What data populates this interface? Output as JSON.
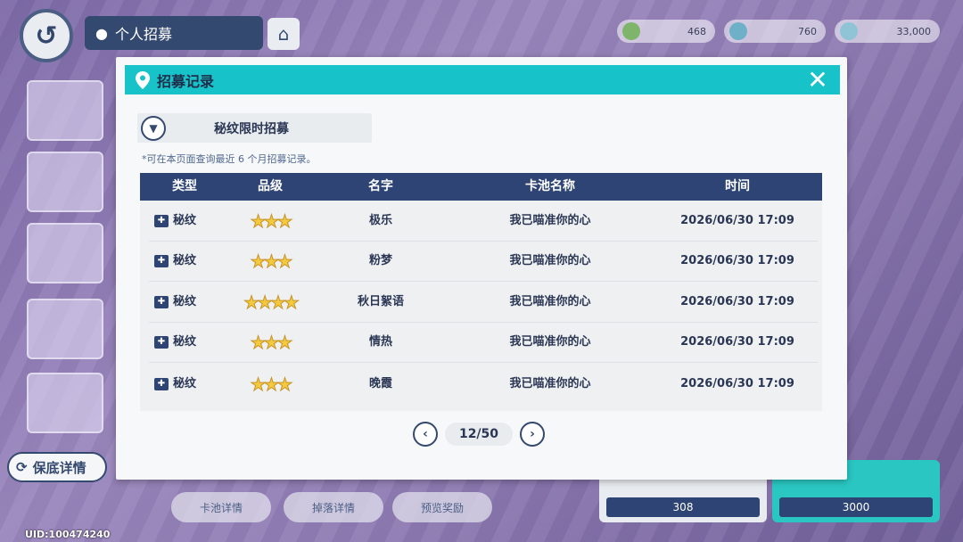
{
  "background": {
    "screen_title": "个人招募",
    "currencies": [
      "468",
      "760",
      "33,000"
    ],
    "bottom_buttons": [
      "卡池详情",
      "掉落详情",
      "预览奖励"
    ],
    "bottom_cards": [
      "308",
      "3000"
    ],
    "baodi_label": "保底详情",
    "uid": "UID:100474240"
  },
  "modal": {
    "title": "招募记录",
    "pool_select": "秘纹限时招募",
    "note": "*可在本页面查询最近 6 个月招募记录。",
    "columns": [
      "类型",
      "品级",
      "名字",
      "卡池名称",
      "时间"
    ],
    "rows": [
      {
        "type": "秘纹",
        "stars": "★★★",
        "name": "极乐",
        "pool": "我已喵准你的心",
        "time": "2026/06/30 17:09"
      },
      {
        "type": "秘纹",
        "stars": "★★★",
        "name": "粉梦",
        "pool": "我已喵准你的心",
        "time": "2026/06/30 17:09"
      },
      {
        "type": "秘纹",
        "stars": "★★★★",
        "name": "秋日絮语",
        "pool": "我已喵准你的心",
        "time": "2026/06/30 17:09"
      },
      {
        "type": "秘纹",
        "stars": "★★★",
        "name": "情热",
        "pool": "我已喵准你的心",
        "time": "2026/06/30 17:09"
      },
      {
        "type": "秘纹",
        "stars": "★★★",
        "name": "晚霞",
        "pool": "我已喵准你的心",
        "time": "2026/06/30 17:09"
      }
    ],
    "page": "12/50"
  }
}
